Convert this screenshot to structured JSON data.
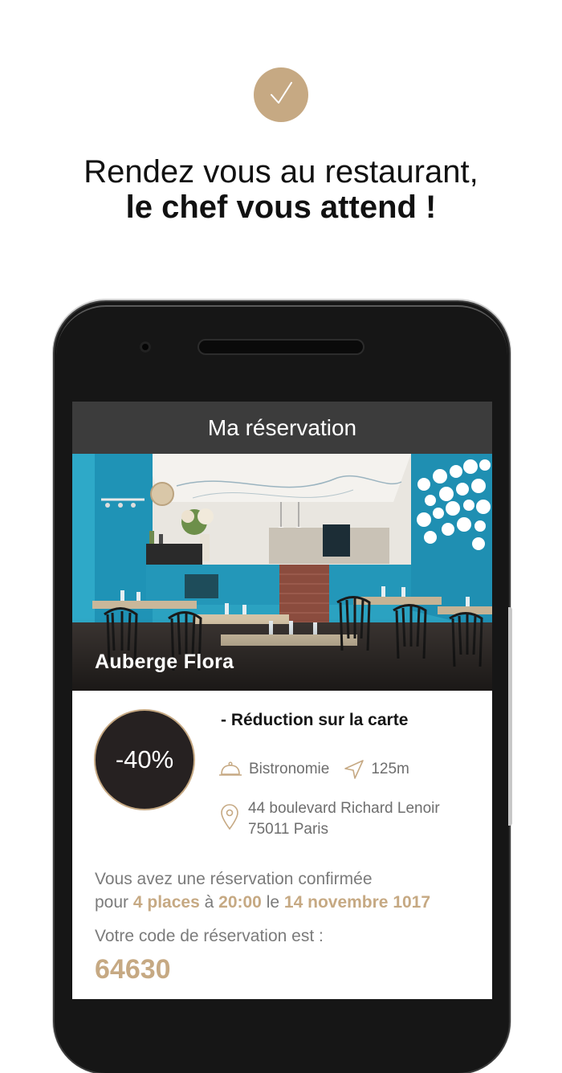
{
  "promo": {
    "headline_line1": "Rendez vous au restaurant,",
    "headline_line2": "le chef vous attend !",
    "check_icon": "checkmark-icon",
    "accent_color": "#c6a983"
  },
  "app": {
    "header_title": "Ma réservation",
    "header_color": "#3c3c3c"
  },
  "restaurant": {
    "name": "Auberge Flora",
    "discount": "-40%",
    "offer": "- Réduction sur la carte",
    "cuisine": "Bistronomie",
    "cuisine_icon": "cloche-icon",
    "distance": "125m",
    "distance_icon": "navigation-arrow-icon",
    "address_line1": "44 boulevard Richard Lenoir",
    "address_line2": "75011 Paris",
    "address_icon": "map-pin-icon"
  },
  "reservation": {
    "line1": "Vous avez une réservation confirmée",
    "line2_prefix": "pour",
    "places": "4 places",
    "at_word": "à",
    "time": "20:00",
    "date_word": "le",
    "date": "14 novembre 1017",
    "code_label": "Votre code de réservation est :",
    "code": "64630"
  }
}
